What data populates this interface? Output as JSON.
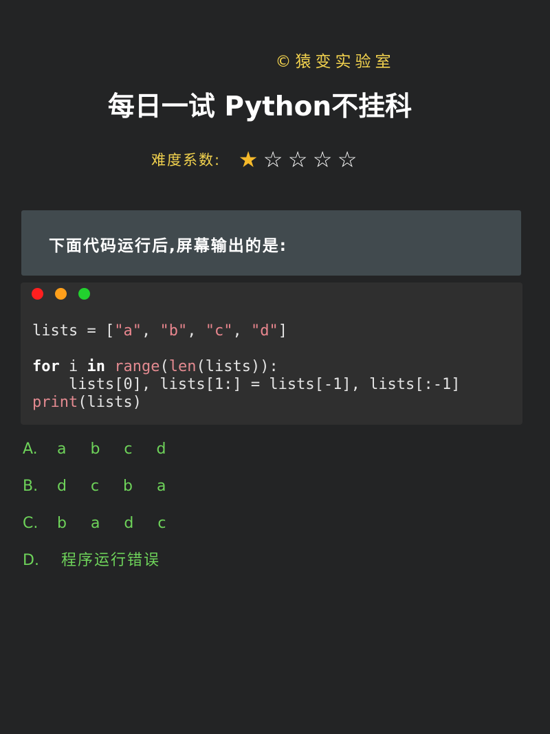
{
  "brand": "©猿变实验室",
  "title": "每日一试 Python不挂科",
  "difficulty": {
    "label": "难度系数:",
    "rating": 1,
    "max": 5,
    "stars": [
      "★",
      "☆",
      "☆",
      "☆",
      "☆"
    ]
  },
  "question": "下面代码运行后,屏幕输出的是:",
  "code_window": {
    "dots": {
      "close_color": "#ff1f1f",
      "minimize_color": "#ff9f1a",
      "maximize_color": "#22d12e"
    },
    "lines": {
      "l1_a": "lists = [",
      "l1_s1": "\"a\"",
      "l1_c1": ", ",
      "l1_s2": "\"b\"",
      "l1_c2": ", ",
      "l1_s3": "\"c\"",
      "l1_c3": ", ",
      "l1_s4": "\"d\"",
      "l1_end": "]",
      "l2_for": "for",
      "l2_i": " i ",
      "l2_in": "in",
      "l2_sp": " ",
      "l2_range": "range",
      "l2_p1": "(",
      "l2_len": "len",
      "l2_rest": "(lists)):",
      "l3": "    lists[0], lists[1:] = lists[-1], lists[:-1]",
      "l4_print": "print",
      "l4_rest": "(lists)"
    }
  },
  "options": [
    {
      "letter": "A.",
      "text": "a b c d"
    },
    {
      "letter": "B.",
      "text": "d c b a"
    },
    {
      "letter": "C.",
      "text": "b a d c"
    },
    {
      "letter": "D.",
      "text": "程序运行错误"
    }
  ],
  "colors": {
    "background": "#232425",
    "brand": "#f2d24e",
    "option_green": "#6ed35a",
    "star_filled": "#f5b92a"
  }
}
